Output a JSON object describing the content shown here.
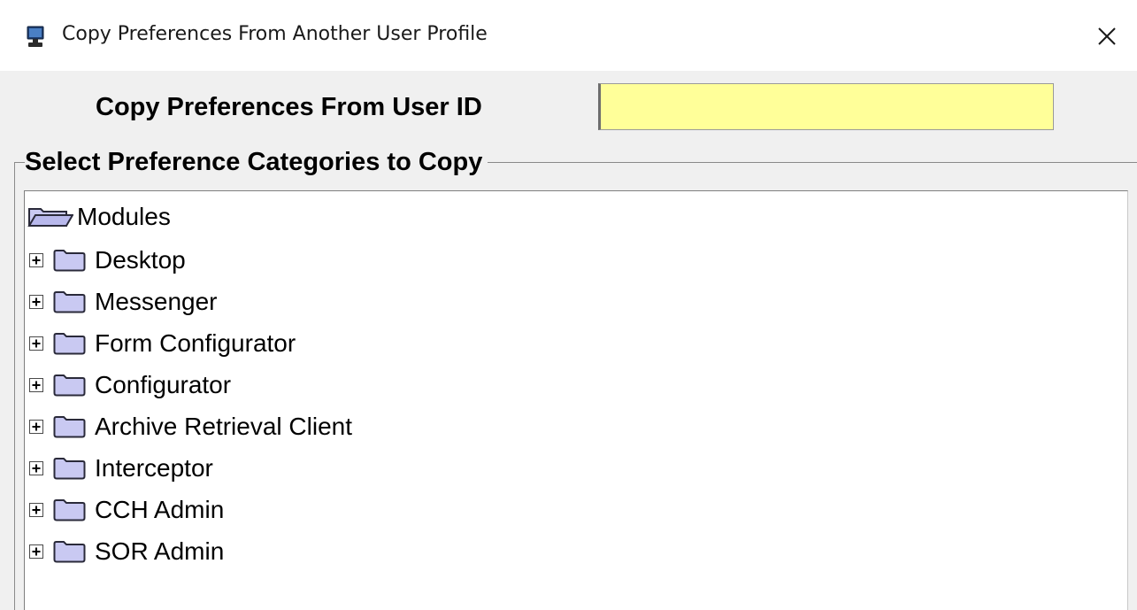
{
  "window": {
    "title": "Copy Preferences From Another User Profile",
    "close_symbol": "✕"
  },
  "user_id": {
    "label": "Copy Preferences From User ID",
    "value": "",
    "background_color": "#ffff99"
  },
  "categories": {
    "group_title": "Select Preference Categories to Copy",
    "root": {
      "label": "Modules",
      "icon": "open-folder-icon"
    },
    "items": [
      {
        "label": "Desktop",
        "icon": "folder-icon",
        "expander": "plus"
      },
      {
        "label": "Messenger",
        "icon": "folder-icon",
        "expander": "plus"
      },
      {
        "label": "Form Configurator",
        "icon": "folder-icon",
        "expander": "plus"
      },
      {
        "label": "Configurator",
        "icon": "folder-icon",
        "expander": "plus"
      },
      {
        "label": "Archive Retrieval Client",
        "icon": "folder-icon",
        "expander": "plus"
      },
      {
        "label": "Interceptor",
        "icon": "folder-icon",
        "expander": "plus"
      },
      {
        "label": "CCH Admin",
        "icon": "folder-icon",
        "expander": "plus"
      },
      {
        "label": "SOR Admin",
        "icon": "folder-icon",
        "expander": "plus"
      }
    ]
  },
  "colors": {
    "folder_fill": "#c9c9f2",
    "folder_stroke": "#2a2a3a",
    "window_background": "#f0f0f0"
  }
}
